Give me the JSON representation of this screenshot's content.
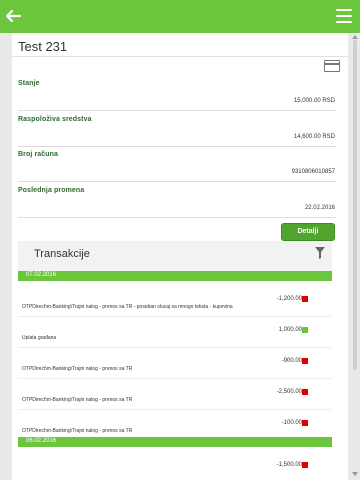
{
  "header": {
    "brand_color": "#6cc63d",
    "back_icon": "arrow-left-icon",
    "menu_icon": "hamburger-menu-icon"
  },
  "account": {
    "title": "Test 231",
    "card_icon": "credit-card-icon",
    "fields": [
      {
        "label": "Stanje",
        "value": "15,000.00 RSD"
      },
      {
        "label": "Raspoloživa sredstva",
        "value": "14,600.00 RSD"
      },
      {
        "label": "Broj računa",
        "value": "9310806010857"
      },
      {
        "label": "Poslednja promena",
        "value": "22.02.2016"
      }
    ],
    "details_button": "Detalji"
  },
  "transactions": {
    "title": "Transakcije",
    "filter_icon": "filter-funnel-icon",
    "groups": [
      {
        "date": "07.02.2016",
        "items": [
          {
            "amount": "-1,200.00",
            "status_color": "#e00000",
            "desc": "OTPDirect\\m-Banking\\Trajni nalog - prenos sa TR - poseban slucaj sa mnogo teksta - kupovina"
          },
          {
            "amount": "1,000.00",
            "status_color": "#6cc63d",
            "desc": "Uplata građana"
          },
          {
            "amount": "-900.00",
            "status_color": "#e00000",
            "desc": "OTPDirect\\m-Banking\\Trajni nalog - prenos sa TR"
          },
          {
            "amount": "-2,500.00",
            "status_color": "#e00000",
            "desc": "OTPDirect\\m-Banking\\Trajni nalog - prenos sa TR"
          },
          {
            "amount": "-100.00",
            "status_color": "#e00000",
            "desc": "OTPDirect\\m-Banking\\Trajni nalog - prenos sa TR"
          }
        ]
      },
      {
        "date": "06.02.2016",
        "items": [
          {
            "amount": "-1,500.00",
            "status_color": "#e00000",
            "desc": ""
          }
        ]
      }
    ]
  }
}
